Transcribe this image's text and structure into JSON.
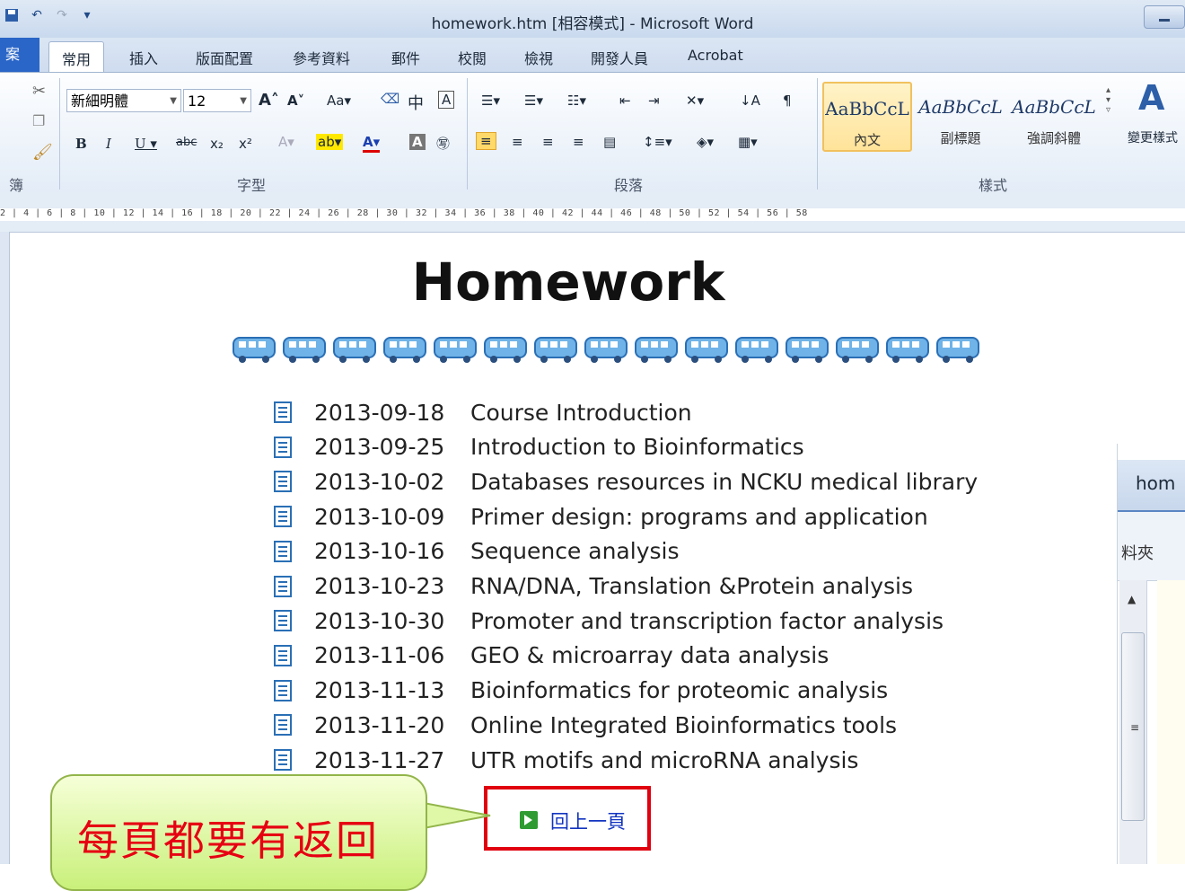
{
  "window": {
    "title": "homework.htm [相容模式] - Microsoft Word"
  },
  "quick_access": {
    "icons": [
      "save-icon",
      "undo-icon",
      "redo-icon",
      "customize-icon"
    ]
  },
  "ribbon_tabs": {
    "file": "案",
    "items": [
      "常用",
      "插入",
      "版面配置",
      "參考資料",
      "郵件",
      "校閱",
      "檢視",
      "開發人員",
      "Acrobat"
    ],
    "active_index": 0
  },
  "ribbon": {
    "font_name": "新細明體",
    "font_size": "12",
    "group_clipboard": "簿",
    "group_font": "字型",
    "group_paragraph": "段落",
    "group_styles": "樣式",
    "styles": [
      {
        "sample": "AaBbCcL",
        "name": "內文"
      },
      {
        "sample": "AaBbCcL",
        "name": "副標題"
      },
      {
        "sample": "AaBbCcL",
        "name": "強調斜體"
      }
    ],
    "change_styles": "變更樣式"
  },
  "ruler": {
    "numbers": "2 | 4 | 6 | 8 | 10 | 12 | 14 | 16 | 18 | 20 | 22 | 24 | 26 | 28 | 30 | 32 | 34 | 36 | 38 | 40 | 42 | 44 | 46 | 48 | 50 | 52 | 54 | 56 | 58"
  },
  "document": {
    "title": "Homework",
    "deco_count": 15,
    "entries": [
      {
        "date": "2013-09-18",
        "topic": "Course Introduction"
      },
      {
        "date": "2013-09-25",
        "topic": "Introduction to Bioinformatics"
      },
      {
        "date": "2013-10-02",
        "topic": "Databases resources in NCKU medical library"
      },
      {
        "date": "2013-10-09",
        "topic": "Primer design: programs and application"
      },
      {
        "date": "2013-10-16",
        "topic": "Sequence analysis"
      },
      {
        "date": "2013-10-23",
        "topic": "RNA/DNA, Translation &Protein analysis"
      },
      {
        "date": "2013-10-30",
        "topic": "Promoter and transcription factor analysis"
      },
      {
        "date": "2013-11-06",
        "topic": "GEO & microarray data analysis"
      },
      {
        "date": "2013-11-13",
        "topic": "Bioinformatics for proteomic analysis"
      },
      {
        "date": "2013-11-20",
        "topic": "Online Integrated Bioinformatics tools"
      },
      {
        "date": "2013-11-27",
        "topic": "UTR motifs and microRNA analysis"
      }
    ],
    "back_link": "回上一頁"
  },
  "callout": {
    "text": "每頁都要有返回"
  },
  "side_window": {
    "tab": "hom",
    "toolbar_text": "料夾"
  }
}
